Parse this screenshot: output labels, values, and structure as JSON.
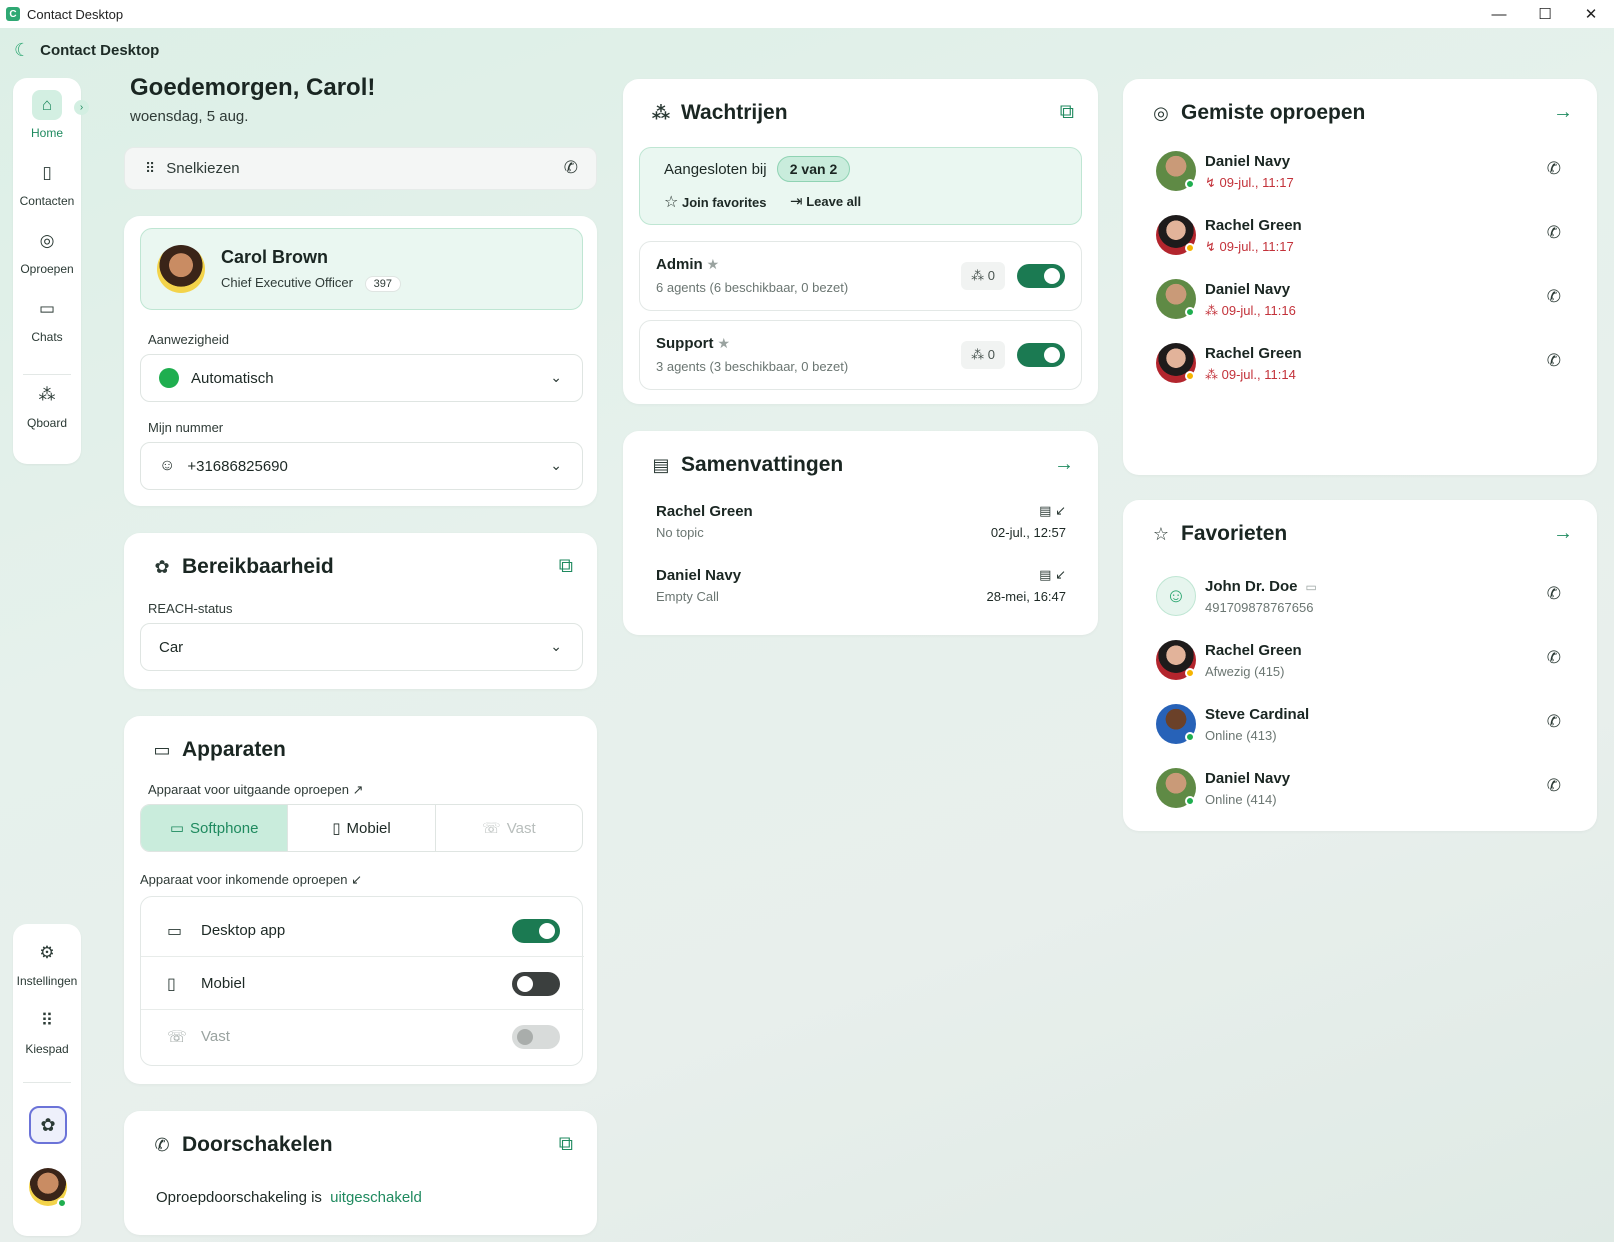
{
  "window": {
    "title": "Contact Desktop",
    "minimize": "—",
    "maximize": "☐",
    "close": "✕"
  },
  "app": {
    "name": "Contact Desktop"
  },
  "nav": {
    "items": [
      {
        "label": "Home",
        "icon": "home-icon"
      },
      {
        "label": "Contacten",
        "icon": "contacts-icon"
      },
      {
        "label": "Oproepen",
        "icon": "calls-icon"
      },
      {
        "label": "Chats",
        "icon": "chat-icon"
      },
      {
        "label": "Qboard",
        "icon": "qboard-icon"
      }
    ],
    "bottom": [
      {
        "label": "Instellingen",
        "icon": "gear-icon"
      },
      {
        "label": "Kiespad",
        "icon": "keypad-icon"
      }
    ]
  },
  "greeting": {
    "title": "Goedemorgen, Carol!",
    "date": "woensdag, 5 aug."
  },
  "quickdial": {
    "placeholder": "Snelkiezen"
  },
  "profile": {
    "name": "Carol Brown",
    "role": "Chief Executive Officer",
    "extension": "397",
    "presence_label": "Aanwezigheid",
    "presence_value": "Automatisch",
    "presence_color": "#1fae4f",
    "number_label": "Mijn nummer",
    "number_value": "+31686825690"
  },
  "reach": {
    "title": "Bereikbaarheid",
    "status_label": "REACH-status",
    "status_value": "Car"
  },
  "devices": {
    "title": "Apparaten",
    "outgoing_label": "Apparaat voor uitgaande oproepen",
    "outgoing_options": [
      "Softphone",
      "Mobiel",
      "Vast"
    ],
    "outgoing_selected": "Softphone",
    "incoming_label": "Apparaat voor inkomende oproepen",
    "incoming": [
      {
        "label": "Desktop app",
        "state": "on"
      },
      {
        "label": "Mobiel",
        "state": "off"
      },
      {
        "label": "Vast",
        "state": "disabled"
      }
    ]
  },
  "forwarding": {
    "title": "Doorschakelen",
    "text": "Oproepdoorschakeling is",
    "status": "uitgeschakeld"
  },
  "queues": {
    "title": "Wachtrijen",
    "joined_label": "Aangesloten bij",
    "joined_badge": "2 van 2",
    "join_favorites": "Join favorites",
    "leave_all": "Leave all",
    "items": [
      {
        "name": "Admin",
        "sub": "6 agents (6 beschikbaar, 0 bezet)",
        "count": "0"
      },
      {
        "name": "Support",
        "sub": "3 agents (3 beschikbaar, 0 bezet)",
        "count": "0"
      }
    ]
  },
  "summaries": {
    "title": "Samenvattingen",
    "items": [
      {
        "name": "Rachel Green",
        "topic": "No topic",
        "time": "02-jul., 12:57"
      },
      {
        "name": "Daniel Navy",
        "topic": "Empty Call",
        "time": "28-mei, 16:47"
      }
    ]
  },
  "missed": {
    "title": "Gemiste oproepen",
    "items": [
      {
        "name": "Daniel Navy",
        "time": "09-jul., 11:17",
        "status": "#1fae4f"
      },
      {
        "name": "Rachel Green",
        "time": "09-jul., 11:17",
        "status": "#f5b400"
      },
      {
        "name": "Daniel Navy",
        "time": "09-jul., 11:16",
        "status": "#1fae4f"
      },
      {
        "name": "Rachel Green",
        "time": "09-jul., 11:14",
        "status": "#f5b400"
      }
    ]
  },
  "favorites": {
    "title": "Favorieten",
    "items": [
      {
        "name": "John Dr. Doe",
        "sub": "491709878767656"
      },
      {
        "name": "Rachel Green",
        "sub": "Afwezig (415)",
        "status": "#f5b400"
      },
      {
        "name": "Steve Cardinal",
        "sub": "Online (413)",
        "status": "#1fae4f"
      },
      {
        "name": "Daniel Navy",
        "sub": "Online (414)",
        "status": "#1fae4f"
      }
    ]
  }
}
